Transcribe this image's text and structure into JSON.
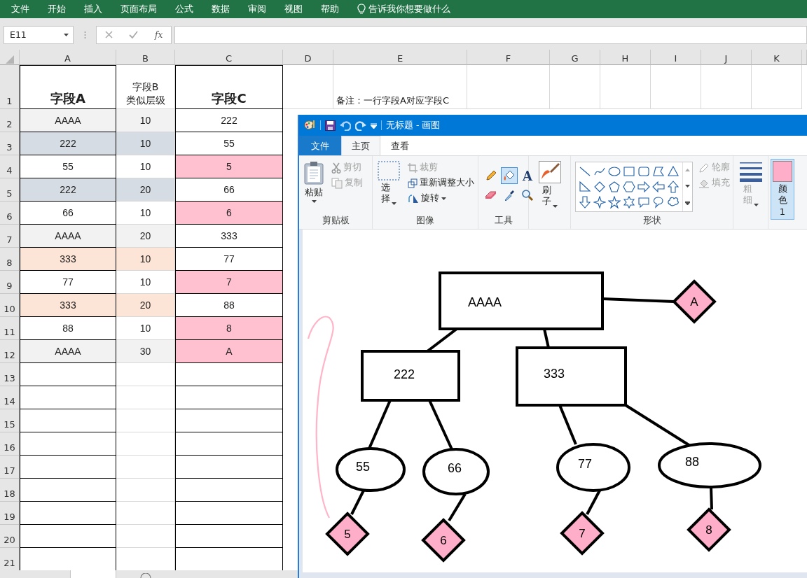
{
  "excel": {
    "menu": [
      "文件",
      "开始",
      "插入",
      "页面布局",
      "公式",
      "数据",
      "审阅",
      "视图",
      "帮助"
    ],
    "tell_me": "告诉我你想要做什么",
    "name_box": "E11",
    "function_label": "fx",
    "columns": [
      "A",
      "B",
      "C",
      "D",
      "E",
      "F",
      "G",
      "H",
      "I",
      "J",
      "K"
    ],
    "header_row": {
      "number": "1",
      "field_a": "字段A",
      "field_b": "字段B\n类似层级",
      "field_c": "字段C",
      "note": "备注：一行字段A对应字段C"
    },
    "rows": [
      {
        "number": "2",
        "a": "AAAA",
        "b": "10",
        "c": "222",
        "color": "#f2f2f2",
        "c_highlight": false
      },
      {
        "number": "3",
        "a": "222",
        "b": "10",
        "c": "55",
        "color": "#d6dce4",
        "c_highlight": false
      },
      {
        "number": "4",
        "a": "55",
        "b": "10",
        "c": "5",
        "color": "#ffffff",
        "c_highlight": true
      },
      {
        "number": "5",
        "a": "222",
        "b": "20",
        "c": "66",
        "color": "#d6dce4",
        "c_highlight": false
      },
      {
        "number": "6",
        "a": "66",
        "b": "10",
        "c": "6",
        "color": "#ffffff",
        "c_highlight": true
      },
      {
        "number": "7",
        "a": "AAAA",
        "b": "20",
        "c": "333",
        "color": "#f2f2f2",
        "c_highlight": false
      },
      {
        "number": "8",
        "a": "333",
        "b": "10",
        "c": "77",
        "color": "#fce4d6",
        "c_highlight": false
      },
      {
        "number": "9",
        "a": "77",
        "b": "10",
        "c": "7",
        "color": "#ffffff",
        "c_highlight": true
      },
      {
        "number": "10",
        "a": "333",
        "b": "20",
        "c": "88",
        "color": "#fce4d6",
        "c_highlight": false
      },
      {
        "number": "11",
        "a": "88",
        "b": "10",
        "c": "8",
        "color": "#ffffff",
        "c_highlight": true
      },
      {
        "number": "12",
        "a": "AAAA",
        "b": "30",
        "c": "A",
        "color": "#f2f2f2",
        "c_highlight": true
      },
      {
        "number": "13"
      },
      {
        "number": "14"
      },
      {
        "number": "15"
      },
      {
        "number": "16"
      },
      {
        "number": "17"
      },
      {
        "number": "18"
      },
      {
        "number": "19"
      },
      {
        "number": "20"
      },
      {
        "number": "21"
      }
    ]
  },
  "paint": {
    "title": "无标题 - 画图",
    "tabs": [
      {
        "label": "文件",
        "kind": "file",
        "selected": false
      },
      {
        "label": "主页",
        "kind": "tab",
        "selected": true
      },
      {
        "label": "查看",
        "kind": "tab",
        "selected": false
      }
    ],
    "clipboard": {
      "label": "剪贴板",
      "paste": "粘贴",
      "cut": {
        "label": "剪切",
        "disabled": true
      },
      "copy": {
        "label": "复制",
        "disabled": true
      }
    },
    "image": {
      "label": "图像",
      "select": "选择",
      "crop": {
        "label": "裁剪",
        "disabled": true
      },
      "resize": "重新调整大小",
      "rotate": "旋转"
    },
    "tools": {
      "label": "工具",
      "items": [
        {
          "kind": "pencil",
          "selected": false
        },
        {
          "kind": "fill",
          "selected": true
        },
        {
          "kind": "text",
          "text": "A",
          "selected": false
        },
        {
          "kind": "eraser",
          "selected": false
        },
        {
          "kind": "picker",
          "selected": false
        },
        {
          "kind": "magnifier",
          "selected": false
        }
      ]
    },
    "brush": {
      "label": "刷子"
    },
    "shapes": {
      "label": "形状",
      "outline": {
        "label": "轮廓",
        "disabled": true
      },
      "fill": {
        "label": "填充",
        "disabled": true
      }
    },
    "size": {
      "label": "粗细",
      "disabled": true
    },
    "color1": {
      "label": "颜色 1",
      "color": "#ffaec9",
      "selected": true
    },
    "diagram": {
      "kind": "rect",
      "text": "AAAA",
      "children": [
        {
          "kind": "diamond",
          "text": "A"
        },
        {
          "kind": "rect",
          "text": "222",
          "children": [
            {
              "kind": "ellipse",
              "text": "55",
              "children": [
                {
                  "kind": "diamond",
                  "text": "5"
                }
              ]
            },
            {
              "kind": "ellipse",
              "text": "66",
              "children": [
                {
                  "kind": "diamond",
                  "text": "6"
                }
              ]
            }
          ]
        },
        {
          "kind": "rect",
          "text": "333",
          "children": [
            {
              "kind": "ellipse",
              "text": "77",
              "children": [
                {
                  "kind": "diamond",
                  "text": "7"
                }
              ]
            },
            {
              "kind": "ellipse",
              "text": "88",
              "children": [
                {
                  "kind": "diamond",
                  "text": "8"
                }
              ]
            }
          ]
        }
      ]
    }
  }
}
